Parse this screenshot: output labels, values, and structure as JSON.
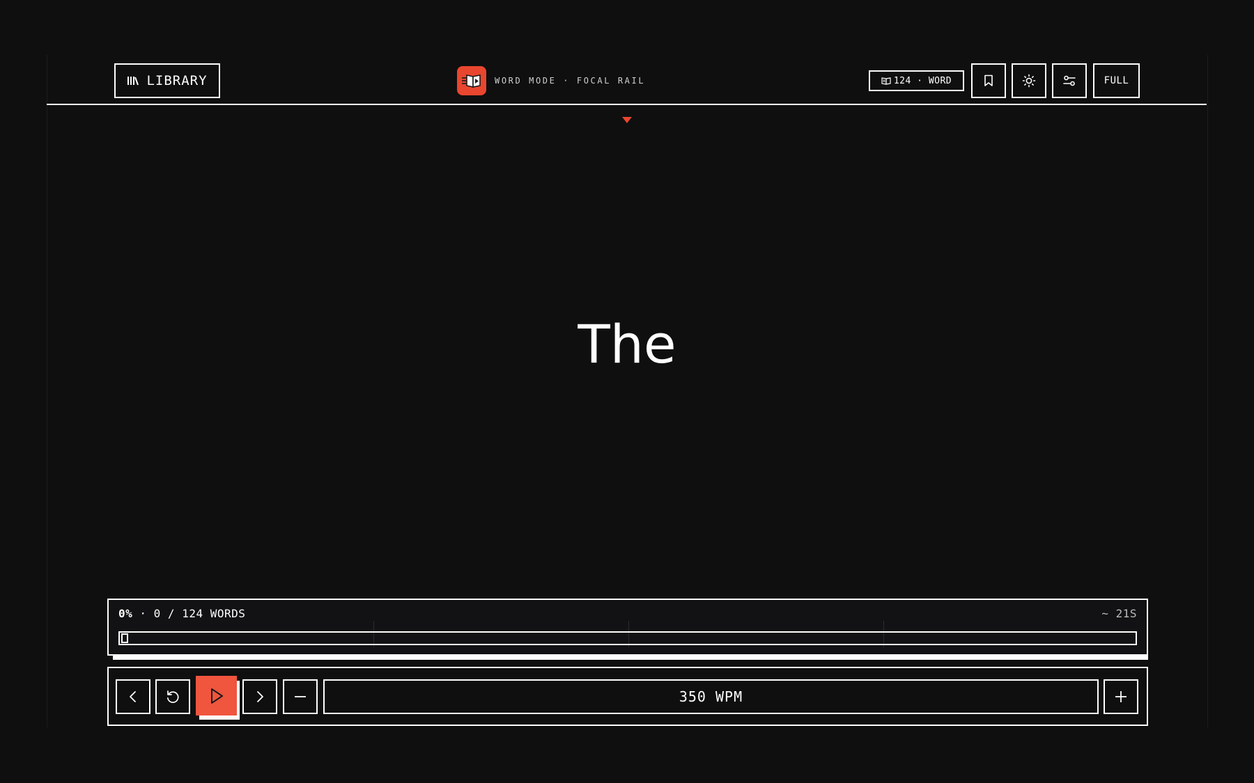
{
  "header": {
    "library_label": "LIBRARY",
    "brand_text": "WORD MODE · FOCAL RAIL",
    "word_chip_label": "124 · WORD",
    "full_label": "FULL"
  },
  "reader": {
    "current_word": "The"
  },
  "progress": {
    "percent_text": "0%",
    "count_text": " · 0 / 124 WORDS",
    "eta_text": "~ 21S",
    "fraction": 0
  },
  "controls": {
    "wpm_label": "350 WPM"
  },
  "colors": {
    "accent": "#e8462f",
    "background": "#0f0f10",
    "foreground": "#ffffff"
  },
  "icons": {
    "library": "library-icon",
    "brand": "book-play-icon",
    "chip": "book-open-icon",
    "bookmark": "bookmark-icon",
    "theme": "sun-icon",
    "settings": "sliders-icon",
    "prev": "chevron-left-icon",
    "restart": "rotate-ccw-icon",
    "play": "play-icon",
    "next": "chevron-right-icon",
    "slower": "minus-icon",
    "faster": "plus-icon"
  }
}
